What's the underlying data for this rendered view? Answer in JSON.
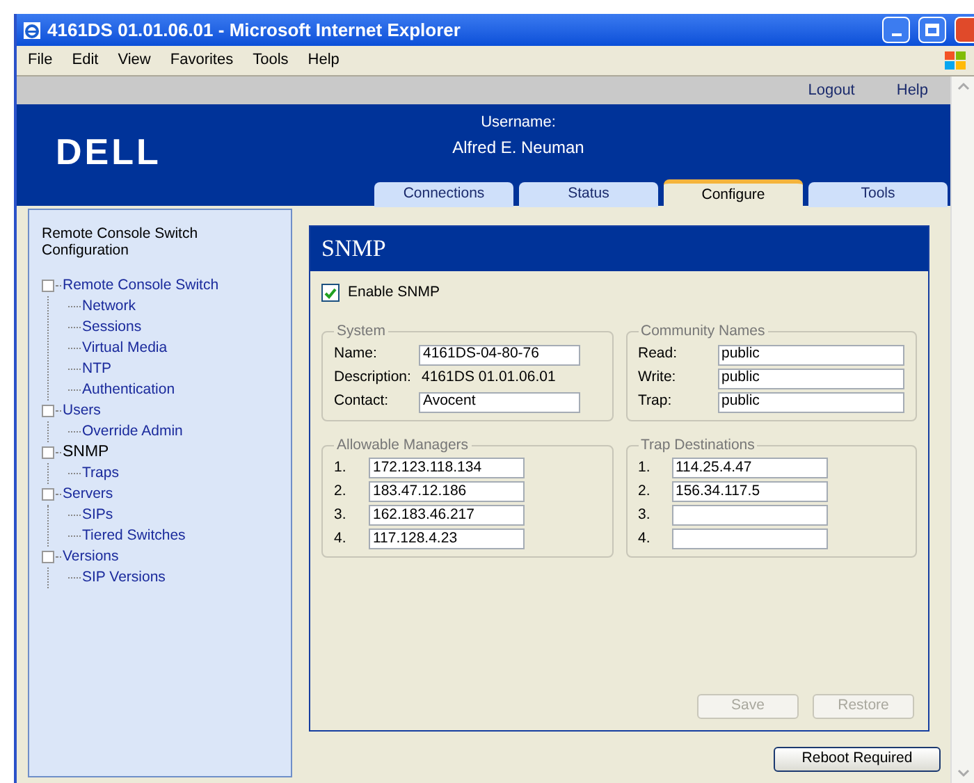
{
  "window": {
    "title": "4161DS 01.01.06.01 - Microsoft Internet Explorer"
  },
  "menu": [
    {
      "label": "File"
    },
    {
      "label": "Edit"
    },
    {
      "label": "View"
    },
    {
      "label": "Favorites"
    },
    {
      "label": "Tools"
    },
    {
      "label": "Help"
    }
  ],
  "top_links": [
    "Logout",
    "Help"
  ],
  "header": {
    "logo": "DELL",
    "username_label": "Username:",
    "username": "Alfred E. Neuman"
  },
  "tabs": [
    {
      "label": "Connections",
      "selected": false
    },
    {
      "label": "Status",
      "selected": false
    },
    {
      "label": "Configure",
      "selected": true
    },
    {
      "label": "Tools",
      "selected": false
    }
  ],
  "sidebar": {
    "title": "Remote Console Switch Configuration",
    "items": [
      {
        "label": "Remote Console Switch",
        "selected": false,
        "children": [
          {
            "label": "Network",
            "selected": false
          },
          {
            "label": "Sessions",
            "selected": false
          },
          {
            "label": "Virtual Media",
            "selected": false
          },
          {
            "label": "NTP",
            "selected": false
          },
          {
            "label": "Authentication",
            "selected": false
          }
        ]
      },
      {
        "label": "Users",
        "selected": false,
        "children": [
          {
            "label": "Override Admin",
            "selected": false
          }
        ]
      },
      {
        "label": "SNMP",
        "selected": true,
        "children": [
          {
            "label": "Traps",
            "selected": false
          }
        ]
      },
      {
        "label": "Servers",
        "selected": false,
        "children": [
          {
            "label": "SIPs",
            "selected": false
          },
          {
            "label": "Tiered Switches",
            "selected": false
          }
        ]
      },
      {
        "label": "Versions",
        "selected": false,
        "children": [
          {
            "label": "SIP Versions",
            "selected": false
          }
        ]
      }
    ]
  },
  "panel": {
    "title": "SNMP",
    "enable": {
      "label": "Enable SNMP",
      "checked": true
    },
    "system": {
      "title": "System",
      "rows": [
        {
          "kind": "input",
          "label": "Name:",
          "value": "4161DS-04-80-76"
        },
        {
          "kind": "text",
          "label": "Description:",
          "value": "4161DS 01.01.06.01"
        },
        {
          "kind": "input",
          "label": "Contact:",
          "value": "Avocent"
        }
      ]
    },
    "community": {
      "title": "Community Names",
      "rows": [
        {
          "label": "Read:",
          "value": "public"
        },
        {
          "label": "Write:",
          "value": "public"
        },
        {
          "label": "Trap:",
          "value": "public"
        }
      ]
    },
    "managers": {
      "title": "Allowable Managers",
      "rows": [
        {
          "label": "1.",
          "value": "172.123.118.134"
        },
        {
          "label": "2.",
          "value": "183.47.12.186"
        },
        {
          "label": "3.",
          "value": "162.183.46.217"
        },
        {
          "label": "4.",
          "value": "117.128.4.23"
        }
      ]
    },
    "traps": {
      "title": "Trap Destinations",
      "rows": [
        {
          "label": "1.",
          "value": "114.25.4.47"
        },
        {
          "label": "2.",
          "value": "156.34.117.5"
        },
        {
          "label": "3."
        },
        {
          "label": "4."
        }
      ]
    },
    "buttons": [
      {
        "label": "Save",
        "disabled": true
      },
      {
        "label": "Restore",
        "disabled": true
      }
    ]
  },
  "reboot_button": "Reboot Required"
}
